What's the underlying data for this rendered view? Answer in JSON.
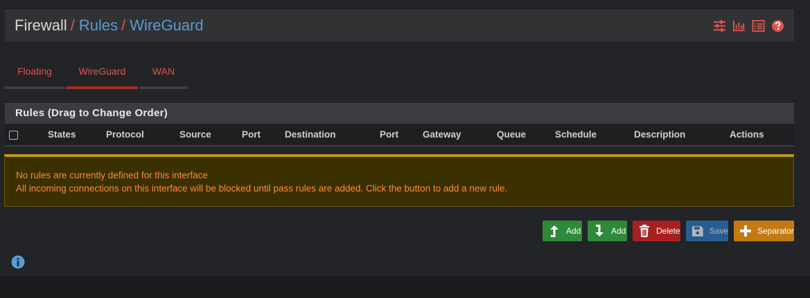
{
  "breadcrumb": {
    "first": "Firewall",
    "sep": "/",
    "second": "Rules",
    "third": "WireGuard"
  },
  "header_icons": [
    "sliders-icon",
    "bar-chart-icon",
    "list-icon",
    "help-icon"
  ],
  "tabs": [
    {
      "label": "Floating",
      "active": false
    },
    {
      "label": "WireGuard",
      "active": true
    },
    {
      "label": "WAN",
      "active": false
    }
  ],
  "panel": {
    "title": "Rules (Drag to Change Order)",
    "columns": [
      "States",
      "Protocol",
      "Source",
      "Port",
      "Destination",
      "Port",
      "Gateway",
      "Queue",
      "Schedule",
      "Description",
      "Actions"
    ]
  },
  "alert": {
    "line1": "No rules are currently defined for this interface",
    "line2": "All incoming connections on this interface will be blocked until pass rules are added. Click the button to add a new rule."
  },
  "buttons": {
    "add_top": "Add",
    "add_bottom": "Add",
    "delete": "Delete",
    "save": "Save",
    "separator": "Separator"
  },
  "colors": {
    "accent_red": "#e2534f",
    "link_blue": "#5b9bd5",
    "alert_text": "#ff8a3d",
    "green": "#2d8a3a",
    "delete_red": "#a82021",
    "save_blue": "#2a5d8f",
    "separator_orange": "#c47a12"
  }
}
